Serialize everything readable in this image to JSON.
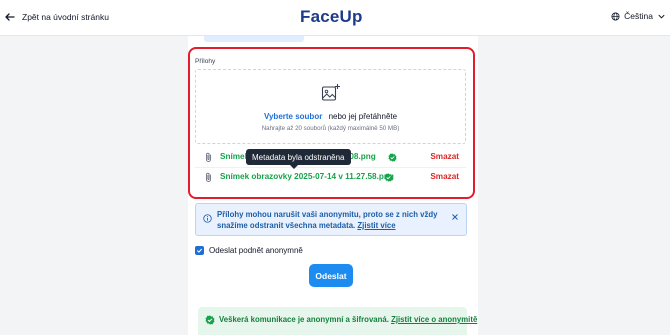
{
  "header": {
    "back_label": "Zpět na úvodní stránku",
    "logo": "FaceUp",
    "language": "Čeština"
  },
  "attachments": {
    "label": "Přílohy",
    "select_file": "Vyberte soubor",
    "or_drag": "nebo jej přetáhněte",
    "limits": "Nahrajte až 20 souborů (každý maximálně 50 MB)",
    "files": [
      {
        "name": "Snímek obrazovky 2025-07-14 v 11.26.08.png",
        "visible_start": "Snímek",
        "visible_end": "26.08.png",
        "delete_label": "Smazat"
      },
      {
        "name": "Snímek obrazovky 2025-07-14 v 11.27.58.png",
        "delete_label": "Smazat"
      }
    ],
    "tooltip": "Metadata byla odstraněna"
  },
  "info_banner": {
    "text": "Přílohy mohou narušit vaši anonymitu, proto se z nich vždy snažíme odstranit všechna metadata.",
    "link": "Zjistit více"
  },
  "anonymous_checkbox": {
    "label": "Odeslat podnět anonymně",
    "checked": true
  },
  "submit_label": "Odeslat",
  "secure_banner": {
    "text": "Veškerá komunikace je anonymní a šifrovaná.",
    "link": "Zjistit více o anonymitě"
  },
  "colors": {
    "brand": "#1e3a8a",
    "primary": "#1d8cf0",
    "success": "#16a34a",
    "danger": "#dc2626",
    "highlight": "#e11d2e"
  }
}
